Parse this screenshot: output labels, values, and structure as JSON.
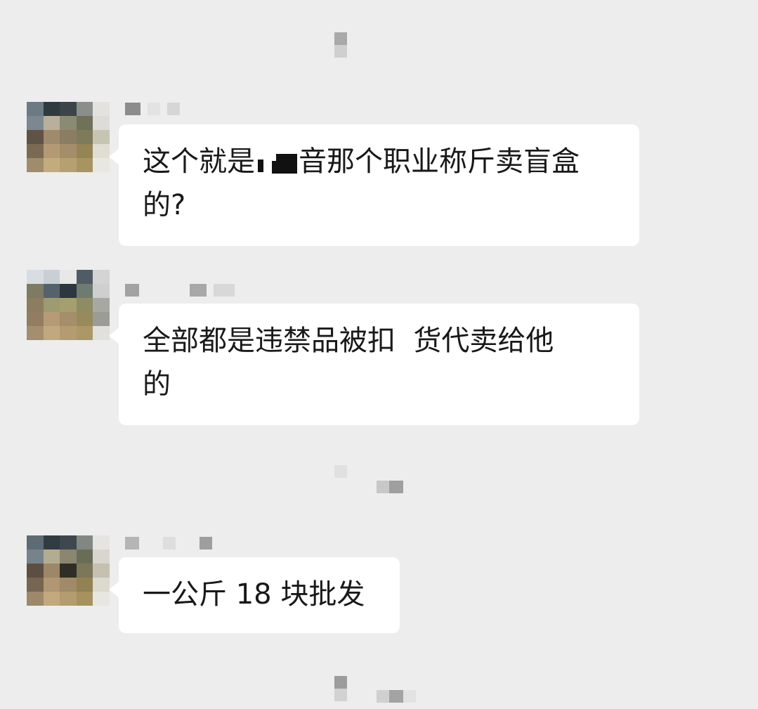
{
  "messages": [
    {
      "text_before": "这个就是",
      "text_after": "音那个职业称斤卖盲盒\n的?"
    },
    {
      "text": "全部都是违禁品被扣  货代卖给他\n的"
    },
    {
      "text": "一公斤 18 块批发"
    }
  ],
  "colors": {
    "background": "#ededed",
    "bubble": "#ffffff",
    "text": "#191919"
  },
  "icons": {
    "avatar": "pixelated-avatar",
    "redaction": "black-redaction-block"
  }
}
